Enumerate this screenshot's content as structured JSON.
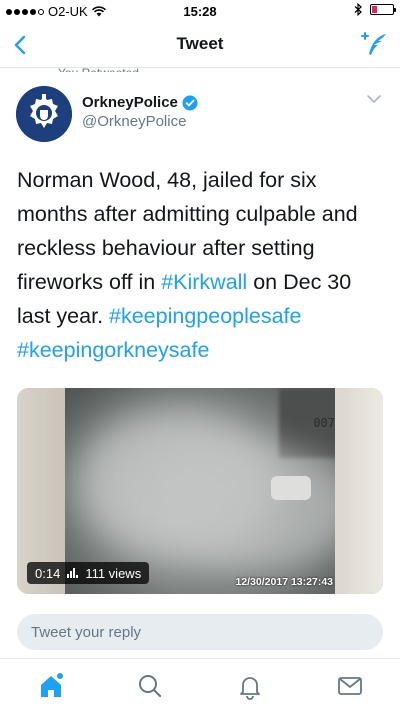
{
  "status": {
    "carrier": "O2-UK",
    "time": "15:28"
  },
  "nav": {
    "title": "Tweet"
  },
  "retweet_context": "You Retweeted",
  "tweet": {
    "display_name": "OrkneyPolice",
    "handle": "@OrkneyPolice",
    "text_part1": "Norman Wood, 48, jailed for six months after admitting culpable and reckless behaviour after setting fireworks off in ",
    "hashtag_kirkwall": "#Kirkwall",
    "text_part2": " on Dec 30 last year. ",
    "hashtag1": "#keepingpeoplesafe",
    "hashtag2": "#keepingorkneysafe",
    "video": {
      "duration": "0:14",
      "views": "111 views",
      "camera_id": "007",
      "timestamp": "12/30/2017 13:27:43"
    }
  },
  "reply": {
    "placeholder": "Tweet your reply"
  },
  "tabs": [
    "home-icon",
    "search-icon",
    "notifications-icon",
    "messages-icon"
  ],
  "colors": {
    "accent": "#1da1f2",
    "text": "#14171a",
    "secondary": "#657786",
    "badge_bg": "#1d3f7d"
  }
}
